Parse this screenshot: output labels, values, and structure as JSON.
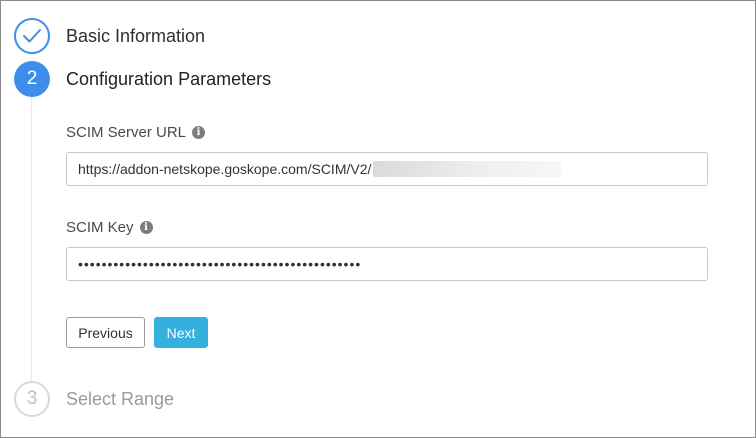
{
  "steps": [
    {
      "number": "",
      "label": "Basic Information",
      "state": "completed",
      "icon": "check-icon"
    },
    {
      "number": "2",
      "label": "Configuration Parameters",
      "state": "active"
    },
    {
      "number": "3",
      "label": "Select Range",
      "state": "pending"
    }
  ],
  "form": {
    "scim_url": {
      "label": "SCIM Server URL",
      "value": "https://addon-netskope.goskope.com/SCIM/V2/",
      "info_icon": "info-icon"
    },
    "scim_key": {
      "label": "SCIM Key",
      "value": "••••••••••••••••••••••••••••••••••••••••••••••••",
      "info_icon": "info-icon"
    }
  },
  "buttons": {
    "previous": "Previous",
    "next": "Next"
  },
  "colors": {
    "accent": "#3d8ee8",
    "next_button": "#33b0de",
    "pending": "#c2c2c2"
  }
}
